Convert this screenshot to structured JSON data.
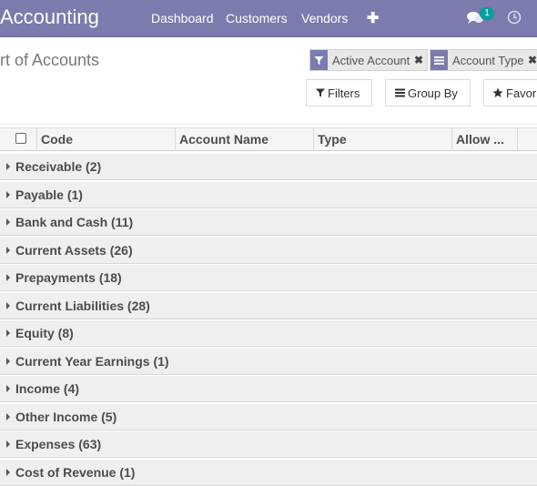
{
  "navbar": {
    "app_title": "Accounting",
    "menu": [
      "Dashboard",
      "Customers",
      "Vendors"
    ],
    "plus_label": "✚",
    "chat_badge": "1"
  },
  "control_panel": {
    "title": "rt of Accounts",
    "facets": [
      {
        "label": "Active Account",
        "icon": "filter-icon"
      },
      {
        "label": "Account Type",
        "icon": "group-by-icon"
      }
    ],
    "buttons": {
      "filters": "Filters",
      "group_by": "Group By",
      "favorites": "Favori"
    }
  },
  "list": {
    "columns": [
      "Code",
      "Account Name",
      "Type",
      "Allow ..."
    ],
    "groups": [
      "Receivable (2)",
      "Payable (1)",
      "Bank and Cash (11)",
      "Current Assets (26)",
      "Prepayments (18)",
      "Current Liabilities (28)",
      "Equity (8)",
      "Current Year Earnings (1)",
      "Income (4)",
      "Other Income (5)",
      "Expenses (63)",
      "Cost of Revenue (1)"
    ]
  },
  "colors": {
    "navbar": "#7c7bad",
    "badge": "#00a09d",
    "group_row": "#efefef"
  }
}
